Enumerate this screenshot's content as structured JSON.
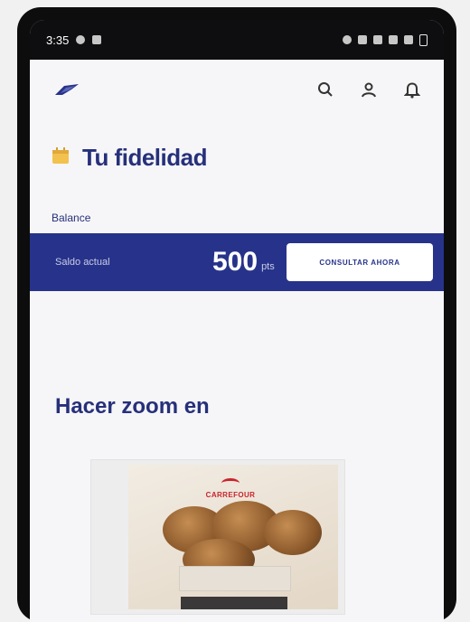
{
  "status_bar": {
    "time": "3:35"
  },
  "app_bar": {
    "logo_icon": "brand-bird-icon",
    "icons": [
      "search-icon",
      "user-icon",
      "bell-icon"
    ]
  },
  "header": {
    "icon": "loyalty-card-icon",
    "title": "Tu fidelidad"
  },
  "balance": {
    "section_label": "Balance",
    "label": "Saldo actual",
    "value": "500",
    "unit": "pts",
    "button_label": "CONSULTAR AHORA"
  },
  "zoom": {
    "title": "Hacer zoom en"
  },
  "product": {
    "brand": "CARREFOUR"
  },
  "colors": {
    "primary": "#27338a",
    "heading": "#26307a",
    "background": "#f6f6f8"
  }
}
